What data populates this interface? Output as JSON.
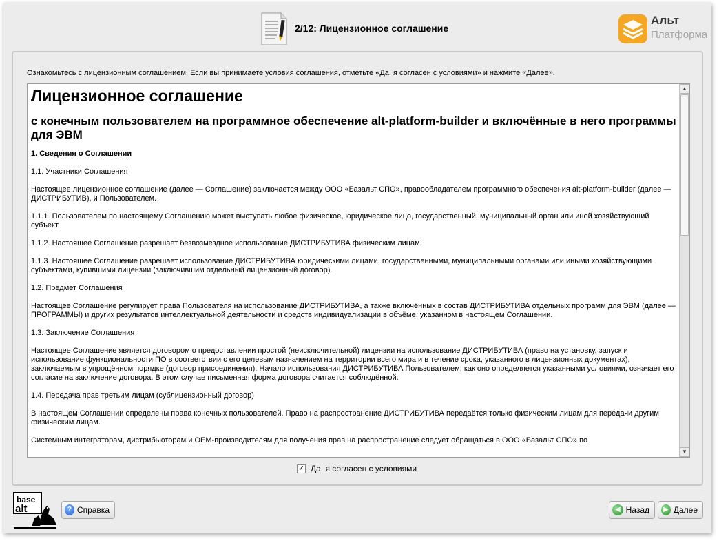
{
  "header": {
    "step_title": "2/12: Лицензионное соглашение",
    "brand_name": "Альт",
    "brand_sub": "Платформа"
  },
  "instruction": "Ознакомьтесь с лицензионным соглашением. Если вы принимаете условия соглашения, отметьте «Да, я согласен с условиями» и нажмите «Далее».",
  "license": {
    "title": "Лицензионное соглашение",
    "subtitle": "с конечным пользователем на программное обеспечение alt-platform-builder и включённые в него программы для ЭВМ",
    "section1": "1. Сведения о Соглашении",
    "p1": "1.1. Участники Соглашения",
    "p2": "Настоящее лицензионное соглашение (далее — Соглашение) заключается между ООО «Базальт СПО», правообладателем программного обеспечения alt-platform-builder (далее — ДИСТРИБУТИВ), и Пользователем.",
    "p3": "1.1.1. Пользователем по настоящему Соглашению может выступать любое физическое, юридическое лицо, государственный, муниципальный орган или иной хозяйствующий субъект.",
    "p4": "1.1.2. Настоящее Соглашение разрешает безвозмездное использование ДИСТРИБУТИВА физическим лицам.",
    "p5": "1.1.3. Настоящее Соглашение разрешает использование ДИСТРИБУТИВА юридическими лицами, государственными, муниципальными органами или иными хозяйствующими субъектами, купившими лицензии (заключившим отдельный лицензионный договор).",
    "p6": "1.2. Предмет Соглашения",
    "p7": "Настоящее Соглашение регулирует права Пользователя на использование ДИСТРИБУТИВА, а также включённых в состав ДИСТРИБУТИВА отдельных программ для ЭВМ (далее — ПРОГРАММЫ) и других результатов интеллектуальной деятельности и средств индивидуализации в объёме, указанном в настоящем Соглашении.",
    "p8": "1.3. Заключение Соглашения",
    "p9": "Настоящее Соглашение является договором о предоставлении простой (неисключительной) лицензии на использование ДИСТРИБУТИВА (право на установку, запуск и использование функциональности ПО в соответствии с его целевым назначением на территории всего мира и в течение срока, указанного в лицензионных документах), заключаемым в упрощённом порядке (договор присоединения). Начало использования ДИСТРИБУТИВА Пользователем, как оно определяется указанными условиями, означает его согласие на заключение договора. В этом случае письменная форма договора считается соблюдённой.",
    "p10": "1.4. Передача прав третьим лицам (сублицензионный договор)",
    "p11": "В настоящем Соглашении определены права конечных пользователей. Право на распространение ДИСТРИБУТИВА передаётся только физическим лицам для передачи другим физическим лицам.",
    "p12": "Системным интеграторам, дистрибьюторам и OEM-производителям для получения прав на распространение следует обращаться в ООО «Базальт СПО» по"
  },
  "agree": {
    "checked": true,
    "check_mark": "✓",
    "label": "Да, я согласен с условиями"
  },
  "footer": {
    "logo_line1": "base",
    "logo_line2": "alt",
    "help_label": "Справка",
    "help_icon": "?",
    "back_label": "Назад",
    "back_icon": "◀",
    "next_label": "Далее",
    "next_icon": "▶"
  },
  "colors": {
    "window_bg": "#ececec",
    "brand_orange": "#f5a623",
    "brand_grey": "#a5a5a5",
    "ok_green": "#2e8f2e",
    "help_blue": "#1f5fd6"
  }
}
